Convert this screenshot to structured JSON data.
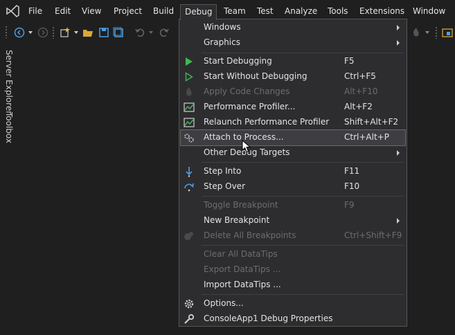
{
  "menubar": {
    "items": [
      "File",
      "Edit",
      "View",
      "Project",
      "Build",
      "Debug",
      "Team",
      "Test",
      "Analyze",
      "Tools",
      "Extensions",
      "Window"
    ],
    "open_item": "Debug"
  },
  "sidebar": {
    "tabs": [
      "Server Explorer",
      "Toolbox"
    ]
  },
  "debug_menu": {
    "items": [
      {
        "label": "Windows",
        "shortcut": "",
        "submenu": true,
        "disabled": false,
        "icon": "none"
      },
      {
        "label": "Graphics",
        "shortcut": "",
        "submenu": true,
        "disabled": false,
        "icon": "none"
      },
      {
        "label": "Start Debugging",
        "shortcut": "F5",
        "submenu": false,
        "disabled": false,
        "icon": "play-filled-icon"
      },
      {
        "label": "Start Without Debugging",
        "shortcut": "Ctrl+F5",
        "submenu": false,
        "disabled": false,
        "icon": "play-outline-icon"
      },
      {
        "label": "Apply Code Changes",
        "shortcut": "Alt+F10",
        "submenu": false,
        "disabled": true,
        "icon": "hot-reload-icon"
      },
      {
        "label": "Performance Profiler...",
        "shortcut": "Alt+F2",
        "submenu": false,
        "disabled": false,
        "icon": "profiler-icon"
      },
      {
        "label": "Relaunch Performance Profiler",
        "shortcut": "Shift+Alt+F2",
        "submenu": false,
        "disabled": false,
        "icon": "profiler-relaunch-icon"
      },
      {
        "label": "Attach to Process...",
        "shortcut": "Ctrl+Alt+P",
        "submenu": false,
        "disabled": false,
        "icon": "gears-icon",
        "highlighted": true
      },
      {
        "label": "Other Debug Targets",
        "shortcut": "",
        "submenu": true,
        "disabled": false,
        "icon": "none"
      },
      {
        "label": "Step Into",
        "shortcut": "F11",
        "submenu": false,
        "disabled": false,
        "icon": "step-into-icon"
      },
      {
        "label": "Step Over",
        "shortcut": "F10",
        "submenu": false,
        "disabled": false,
        "icon": "step-over-icon"
      },
      {
        "label": "Toggle Breakpoint",
        "shortcut": "F9",
        "submenu": false,
        "disabled": true,
        "icon": "none"
      },
      {
        "label": "New Breakpoint",
        "shortcut": "",
        "submenu": true,
        "disabled": false,
        "icon": "none"
      },
      {
        "label": "Delete All Breakpoints",
        "shortcut": "Ctrl+Shift+F9",
        "submenu": false,
        "disabled": true,
        "icon": "delete-breakpoints-icon"
      },
      {
        "label": "Clear All DataTips",
        "shortcut": "",
        "submenu": false,
        "disabled": true,
        "icon": "none"
      },
      {
        "label": "Export DataTips ...",
        "shortcut": "",
        "submenu": false,
        "disabled": true,
        "icon": "none"
      },
      {
        "label": "Import DataTips ...",
        "shortcut": "",
        "submenu": false,
        "disabled": false,
        "icon": "none"
      },
      {
        "label": "Options...",
        "shortcut": "",
        "submenu": false,
        "disabled": false,
        "icon": "gear-icon"
      },
      {
        "label": "ConsoleApp1 Debug Properties",
        "shortcut": "",
        "submenu": false,
        "disabled": false,
        "icon": "wrench-icon"
      }
    ]
  },
  "colors": {
    "accent_green": "#3fb950",
    "accent_blue": "#4a9fe6",
    "menu_bg": "#2d2d30",
    "app_bg": "#1f1f1f"
  }
}
